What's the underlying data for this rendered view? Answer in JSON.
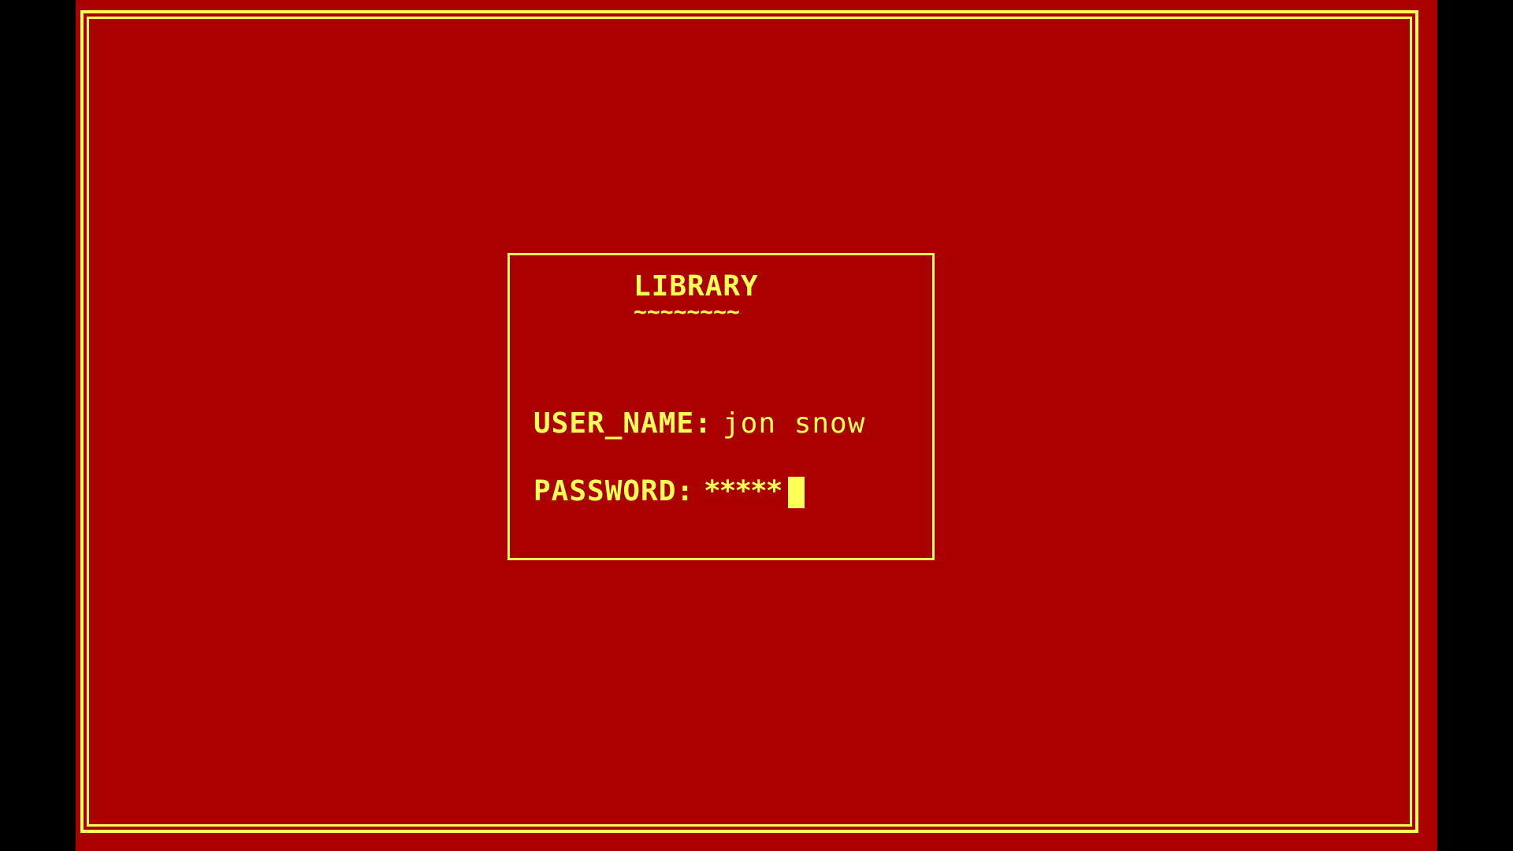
{
  "colors": {
    "background": "#AA0000",
    "foreground": "#FFFF55",
    "letterbox": "#000000"
  },
  "login": {
    "title": "LIBRARY",
    "title_underline": "~~~~~~~~",
    "username_label": "USER_NAME:",
    "username_value": "jon snow",
    "password_label": "PASSWORD:",
    "password_value": "*****"
  }
}
